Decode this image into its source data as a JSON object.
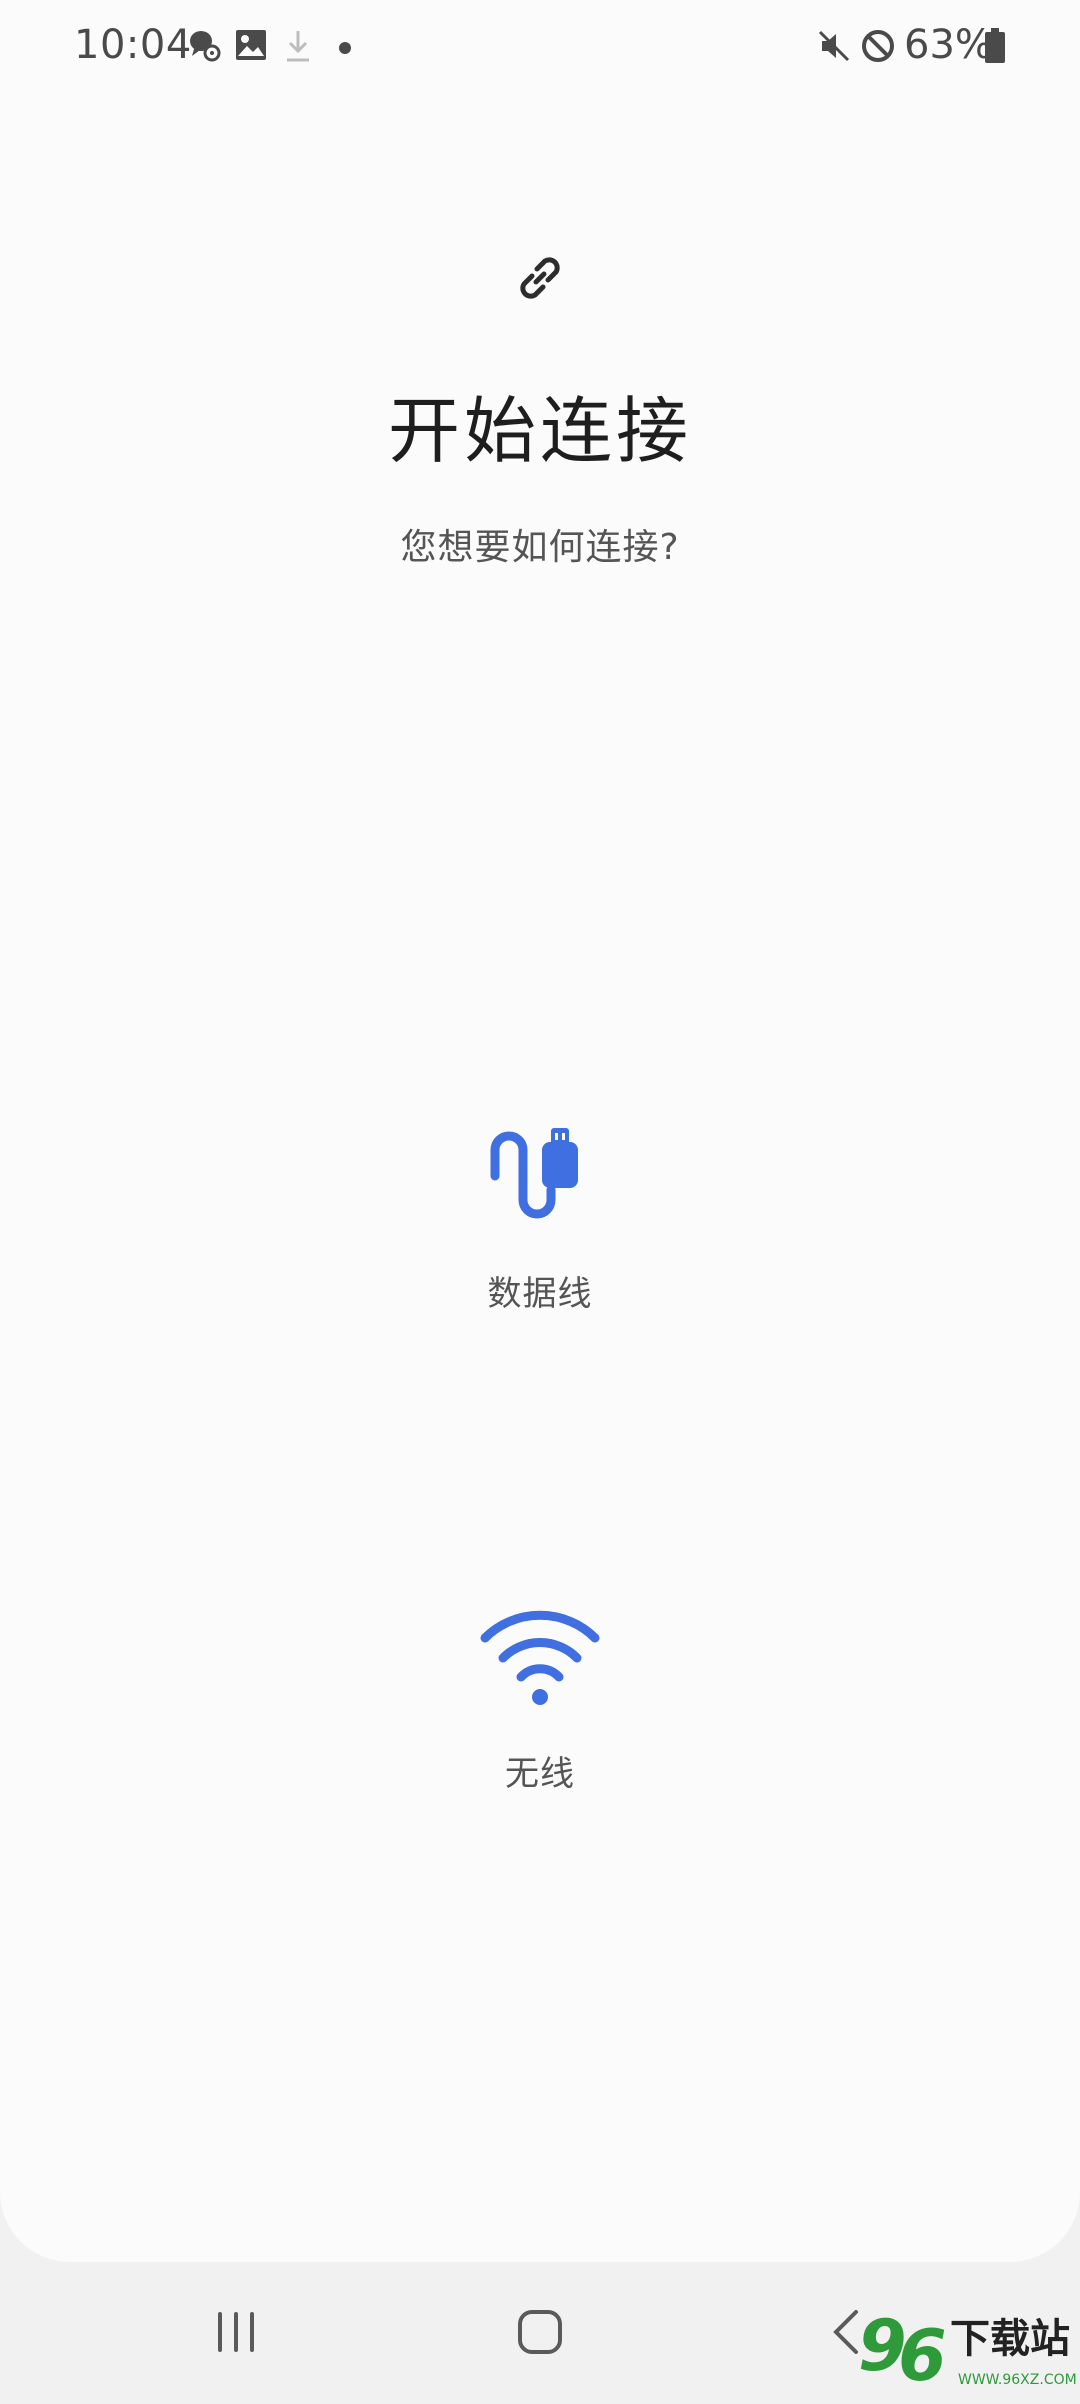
{
  "status_bar": {
    "time": "10:04",
    "icons_left": [
      "chat-settings-icon",
      "image-icon",
      "download-icon",
      "dot-icon"
    ],
    "icons_right": [
      "mute-icon",
      "do-not-disturb-icon",
      "battery-icon"
    ],
    "battery_percent": "63%"
  },
  "main": {
    "header_icon": "link-icon",
    "title": "开始连接",
    "subtitle": "您想要如何连接?",
    "options": [
      {
        "icon": "usb-cable-icon",
        "label": "数据线"
      },
      {
        "icon": "wifi-icon",
        "label": "无线"
      }
    ]
  },
  "nav_bar": {
    "buttons": [
      "recents-button",
      "home-button",
      "back-button"
    ]
  },
  "watermark": {
    "brand": "96下载站",
    "url": "WWW.96XZ.COM"
  },
  "colors": {
    "accent": "#3f6fe0",
    "background": "#fbfbfb",
    "nav_background": "#f1f1f1"
  }
}
